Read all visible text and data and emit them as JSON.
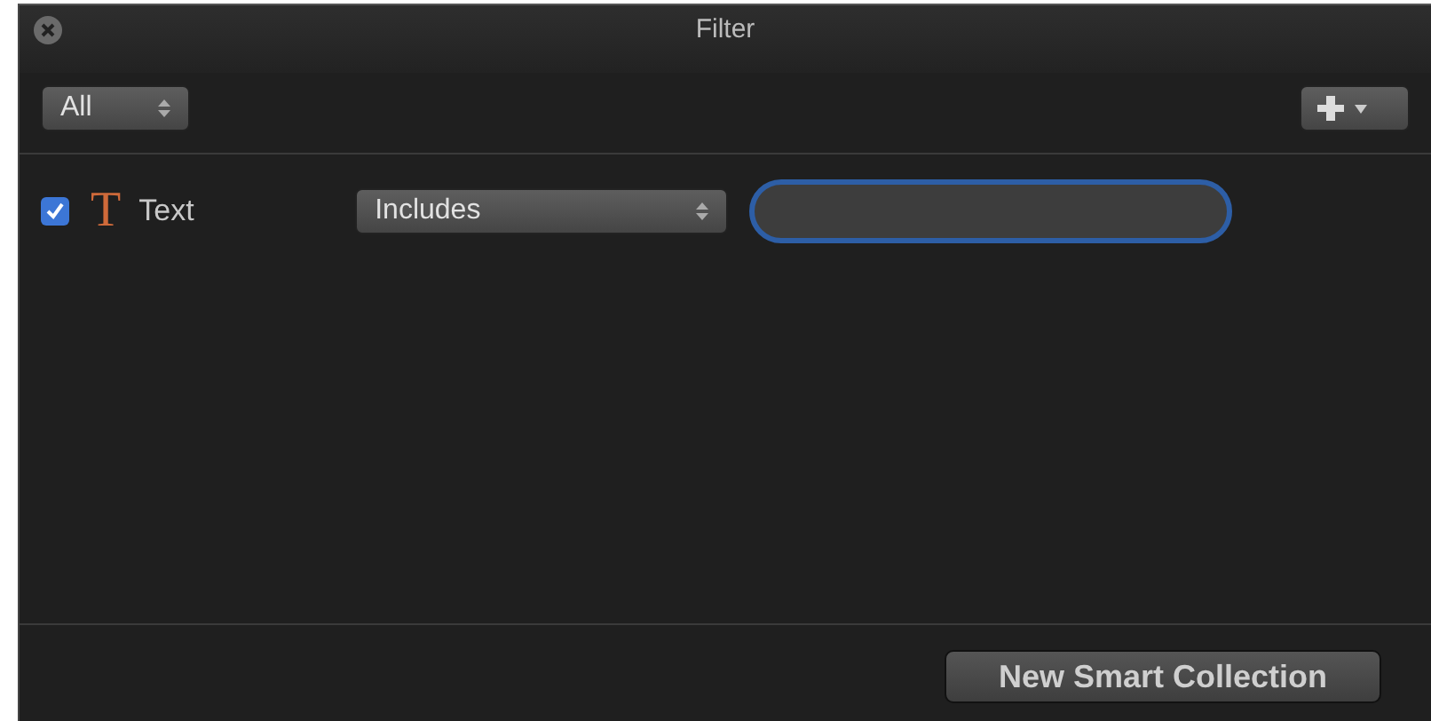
{
  "window": {
    "title": "Filter"
  },
  "scope_menu": {
    "value": "All"
  },
  "rules": [
    {
      "kind": "text",
      "checked": true,
      "icon_glyph": "T",
      "label": "Text",
      "operator": "Includes"
    }
  ],
  "buttons": [
    "New Smart Collection"
  ]
}
